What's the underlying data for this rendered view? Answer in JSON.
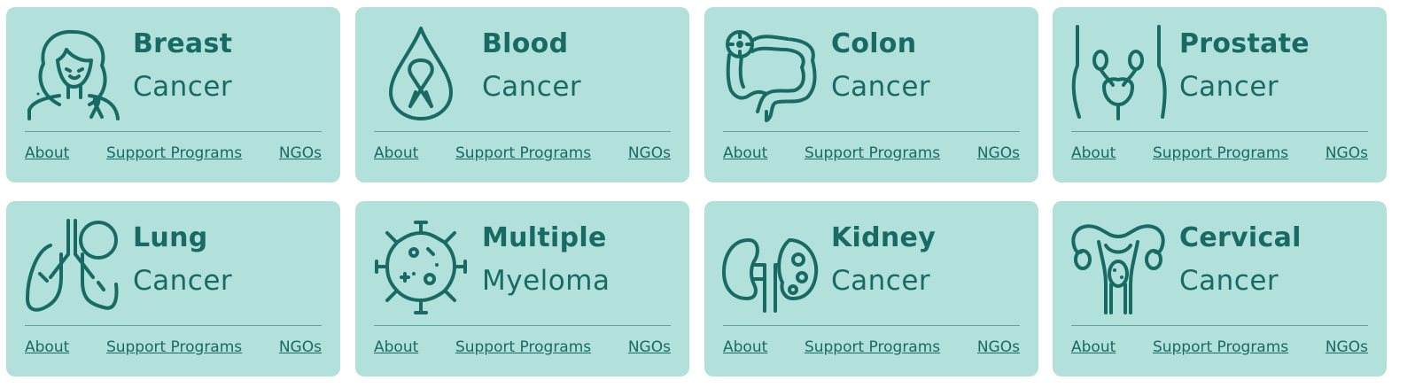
{
  "colors": {
    "card_bg": "#b2e0db",
    "accent": "#176b64"
  },
  "cards": [
    {
      "icon": "breast-cancer-woman-icon",
      "title": "Breast",
      "subtitle": "Cancer",
      "links": [
        "About",
        "Support Programs",
        "NGOs"
      ]
    },
    {
      "icon": "blood-drop-ribbon-icon",
      "title": "Blood",
      "subtitle": "Cancer",
      "links": [
        "About",
        "Support Programs",
        "NGOs"
      ]
    },
    {
      "icon": "colon-icon",
      "title": "Colon",
      "subtitle": "Cancer",
      "links": [
        "About",
        "Support Programs",
        "NGOs"
      ]
    },
    {
      "icon": "prostate-icon",
      "title": "Prostate",
      "subtitle": "Cancer",
      "links": [
        "About",
        "Support Programs",
        "NGOs"
      ]
    },
    {
      "icon": "lungs-icon",
      "title": "Lung",
      "subtitle": "Cancer",
      "links": [
        "About",
        "Support Programs",
        "NGOs"
      ]
    },
    {
      "icon": "myeloma-cell-icon",
      "title": "Multiple",
      "subtitle": "Myeloma",
      "links": [
        "About",
        "Support Programs",
        "NGOs"
      ]
    },
    {
      "icon": "kidney-icon",
      "title": "Kidney",
      "subtitle": "Cancer",
      "links": [
        "About",
        "Support Programs",
        "NGOs"
      ]
    },
    {
      "icon": "uterus-icon",
      "title": "Cervical",
      "subtitle": "Cancer",
      "links": [
        "About",
        "Support Programs",
        "NGOs"
      ]
    }
  ]
}
